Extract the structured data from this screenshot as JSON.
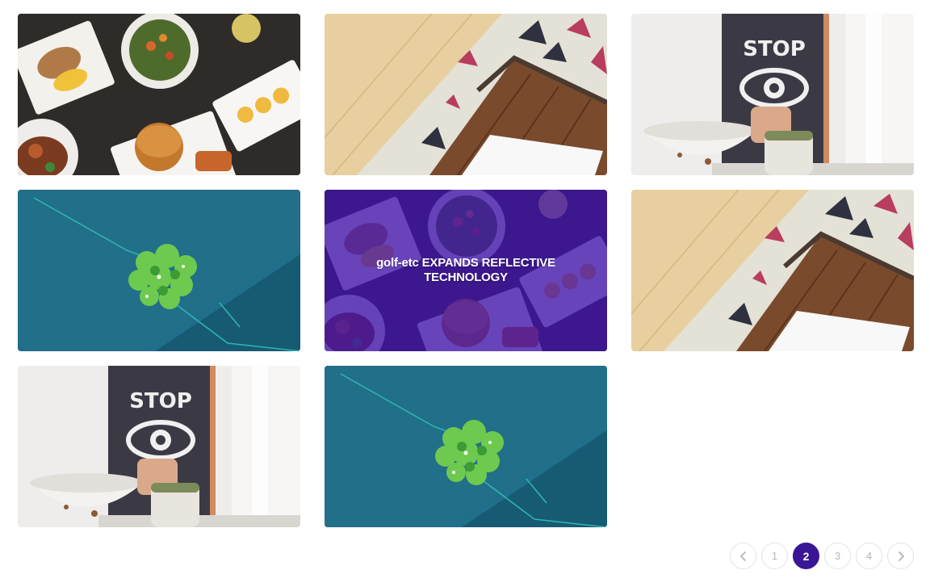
{
  "gallery": {
    "items": [
      {
        "image": "food-platter-photo"
      },
      {
        "image": "wood-floor-rug-photo"
      },
      {
        "image": "stop-sign-bowl-photo"
      },
      {
        "image": "succulent-on-denim-photo"
      },
      {
        "image": "food-platter-photo",
        "overlay_title": "golf-etc EXPANDS REFLECTIVE TECHNOLOGY",
        "overlay_color": "#4012aa"
      },
      {
        "image": "wood-floor-rug-photo"
      },
      {
        "image": "stop-sign-bowl-photo"
      },
      {
        "image": "succulent-on-denim-photo"
      }
    ]
  },
  "pagination": {
    "prev_icon": "chevron-left-icon",
    "next_icon": "chevron-right-icon",
    "pages": [
      "1",
      "2",
      "3",
      "4"
    ],
    "current": "2",
    "active_color": "#3a1696"
  }
}
